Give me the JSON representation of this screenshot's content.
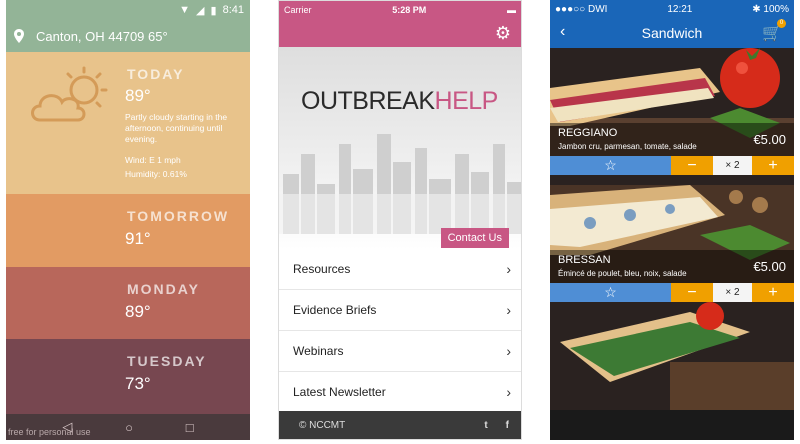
{
  "weather": {
    "status_time": "8:41",
    "location": "Canton, OH 44709 65°",
    "today": {
      "name": "TODAY",
      "temp": "89°",
      "description": "Partly cloudy starting in the afternoon, continuing until evening.",
      "wind": "Wind: E 1 mph",
      "humidity": "Humidity: 0.61%"
    },
    "days": [
      {
        "name": "TOMORROW",
        "temp": "91°"
      },
      {
        "name": "MONDAY",
        "temp": "89°"
      },
      {
        "name": "TUESDAY",
        "temp": "73°"
      }
    ],
    "watermark": "free for personal use",
    "colors": {
      "header": "#93b497",
      "today": "#e8c38b",
      "tomorrow": "#e29b63",
      "monday": "#b8675b",
      "tuesday": "#774750"
    }
  },
  "outbreak": {
    "carrier": "Carrier",
    "status_time": "5:28 PM",
    "title_part1": "OUTBREAK",
    "title_part2": "HELP",
    "contact_label": "Contact Us",
    "menu": [
      "Resources",
      "Evidence Briefs",
      "Webinars",
      "Latest Newsletter"
    ],
    "footer": "© NCCMT",
    "social": [
      "t",
      "f"
    ],
    "colors": {
      "accent": "#c85784",
      "footer": "#3a3a3a"
    }
  },
  "sandwich": {
    "carrier": "●●●○○ DWI",
    "status_time": "12:21",
    "battery": "✱ 100%",
    "title": "Sandwich",
    "cart_count": "0",
    "items": [
      {
        "name": "REGGIANO",
        "ingredients": "Jambon cru, parmesan, tomate, salade",
        "price": "€5.00",
        "qty": "× 2"
      },
      {
        "name": "BRESSAN",
        "ingredients": "Émincé de poulet, bleu, noix, salade",
        "price": "€5.00",
        "qty": "× 2"
      }
    ],
    "colors": {
      "header": "#1a66b8",
      "favorite": "#4f8ed5",
      "stepper": "#f0a000"
    }
  }
}
